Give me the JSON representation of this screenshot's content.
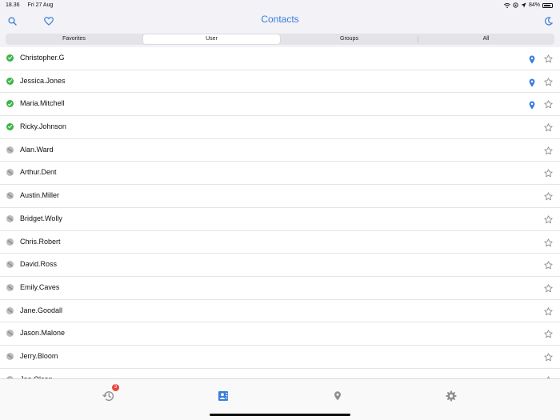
{
  "status_bar": {
    "time": "18.36",
    "date": "Fri 27 Aug",
    "battery": "84%"
  },
  "header": {
    "title": "Contacts"
  },
  "segments": [
    {
      "label": "Favorites",
      "selected": false
    },
    {
      "label": "User",
      "selected": true
    },
    {
      "label": "Groups",
      "selected": false
    },
    {
      "label": "All",
      "selected": false
    }
  ],
  "contacts": [
    {
      "name": "Christopher.G",
      "online": true,
      "location": true
    },
    {
      "name": "Jessica.Jones",
      "online": true,
      "location": true
    },
    {
      "name": "Maria.Mitchell",
      "online": true,
      "location": true
    },
    {
      "name": "Ricky.Johnson",
      "online": true,
      "location": false
    },
    {
      "name": "Alan.Ward",
      "online": false,
      "location": false
    },
    {
      "name": "Arthur.Dent",
      "online": false,
      "location": false
    },
    {
      "name": "Austin.Miller",
      "online": false,
      "location": false
    },
    {
      "name": "Bridget.Wolly",
      "online": false,
      "location": false
    },
    {
      "name": "Chris.Robert",
      "online": false,
      "location": false
    },
    {
      "name": "David.Ross",
      "online": false,
      "location": false
    },
    {
      "name": "Emily.Caves",
      "online": false,
      "location": false
    },
    {
      "name": "Jane.Goodall",
      "online": false,
      "location": false
    },
    {
      "name": "Jason.Malone",
      "online": false,
      "location": false
    },
    {
      "name": "Jerry.Bloom",
      "online": false,
      "location": false
    },
    {
      "name": "Joe.Olson",
      "online": false,
      "location": false
    }
  ],
  "tabbar": {
    "recents_badge": "3",
    "tabs": [
      {
        "name": "recents",
        "icon": "history-icon",
        "active": false
      },
      {
        "name": "contacts",
        "icon": "contacts-book-icon",
        "active": true
      },
      {
        "name": "map",
        "icon": "location-pin-icon",
        "active": false
      },
      {
        "name": "settings",
        "icon": "gear-icon",
        "active": false
      }
    ]
  },
  "colors": {
    "accent": "#3a7ddb",
    "online": "#3cb346",
    "offline": "#bbbbbb",
    "inactive_icon": "#8e8e93",
    "badge": "#e8473f"
  }
}
